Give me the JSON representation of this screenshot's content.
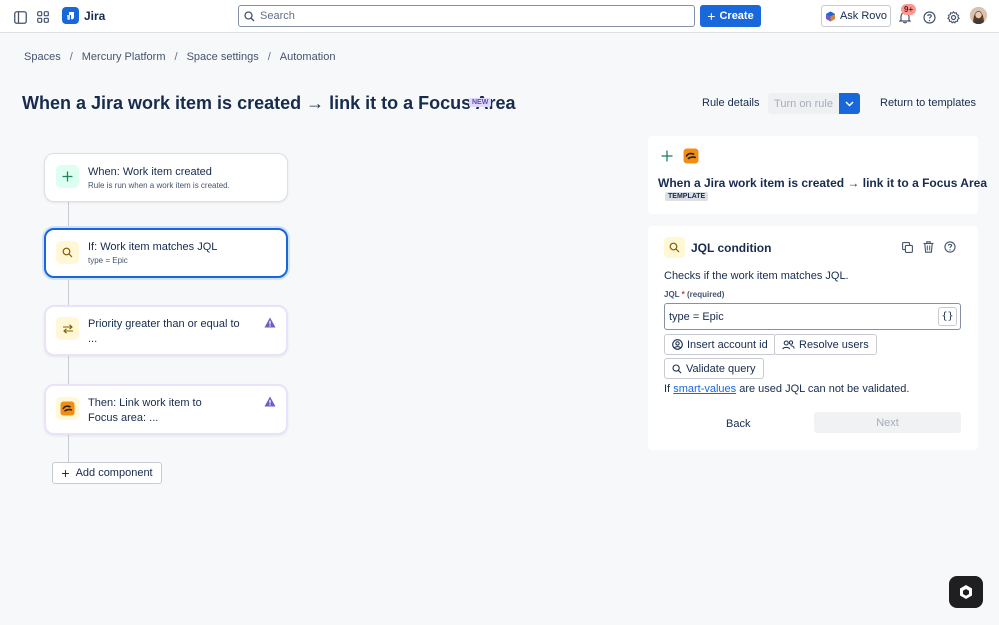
{
  "topbar": {
    "app_name": "Jira",
    "search_placeholder": "Search",
    "create_label": "Create",
    "rovo_label": "Ask Rovo",
    "notifications_badge": "9+"
  },
  "breadcrumb": [
    "Spaces",
    "Mercury Platform",
    "Space settings",
    "Automation"
  ],
  "header": {
    "title": "When a Jira work item is created → link it to a Focus Area",
    "new_badge": "NEW",
    "rule_details": "Rule details",
    "turn_on": "Turn on rule",
    "return": "Return to templates"
  },
  "flow": [
    {
      "title": "When: Work item created",
      "subtitle": "Rule is run when a work item is created.",
      "icon": "plus-icon",
      "warning": false
    },
    {
      "title": "If: Work item matches JQL",
      "subtitle": "type = Epic",
      "icon": "search-icon",
      "warning": false
    },
    {
      "title_lines": [
        "Priority greater than or equal to",
        "..."
      ],
      "icon": "swap-icon",
      "warning": true
    },
    {
      "title_lines": [
        "Then: Link work item to",
        "Focus area: ..."
      ],
      "icon": "focus-area-icon",
      "warning": true
    }
  ],
  "add_component": "Add component",
  "summary_panel": {
    "title": "When a Jira work item is created → link it to a Focus Area",
    "badge": "TEMPLATE"
  },
  "jql_panel": {
    "title": "JQL condition",
    "description": "Checks if the work item matches JQL.",
    "field_label": "JQL",
    "required_mark": "*",
    "required_text": "(required)",
    "field_value": "type = Epic",
    "braces": "{}",
    "insert_account": "Insert account id",
    "resolve_users": "Resolve users",
    "validate_query": "Validate query",
    "note_prefix": "If",
    "note_link": "smart-values",
    "note_suffix": "are used JQL can not be validated.",
    "back": "Back",
    "next": "Next"
  },
  "colors": {
    "brand": "#1868db",
    "selected_border": "#1868db",
    "warning": "#6e5dc6",
    "new_badge_bg": "#dfd8fd"
  }
}
